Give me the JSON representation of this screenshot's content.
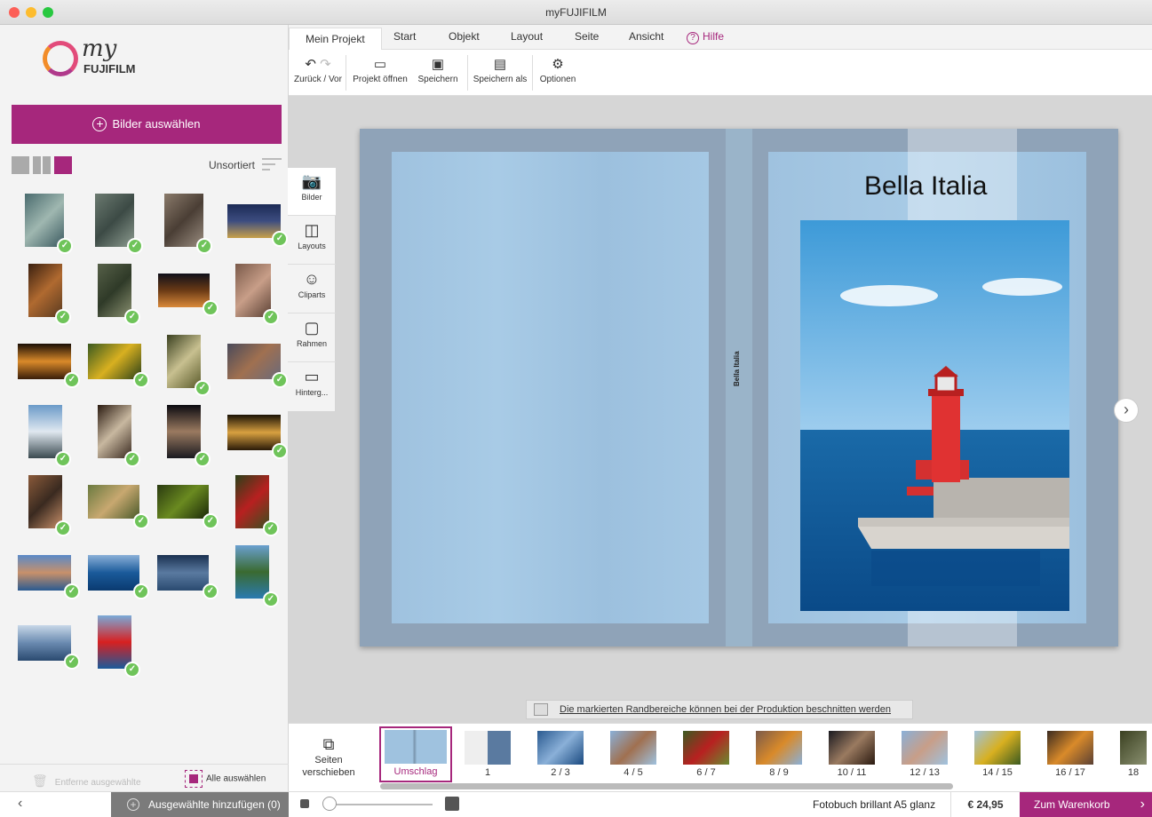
{
  "window": {
    "title": "myFUJIFILM"
  },
  "logo": {
    "my": "my",
    "brand": "FUJIFILM"
  },
  "sidebar": {
    "select_button": "Bilder auswählen",
    "sort_label": "Unsortiert",
    "remove_selected": "Entferne ausgewählte",
    "select_all": "Alle auswählen",
    "add_selected": "Ausgewählte hinzufügen (0)"
  },
  "menu": {
    "tabs": [
      "Mein Projekt",
      "Start",
      "Objekt",
      "Layout",
      "Seite",
      "Ansicht"
    ],
    "help": "Hilfe"
  },
  "ribbon": {
    "undo_redo": "Zurück / Vor",
    "open_project": "Projekt öffnen",
    "save": "Speichern",
    "save_as": "Speichern als",
    "options": "Optionen"
  },
  "side_tabs": [
    "Bilder",
    "Layouts",
    "Cliparts",
    "Rahmen",
    "Hinterg..."
  ],
  "book": {
    "title": "Bella Italia",
    "spine": "Bella Italia"
  },
  "notice": "Die markierten Randbereiche können bei der Produktion beschnitten werden",
  "pages": {
    "move_label": "Seiten verschieben",
    "items": [
      "Umschlag",
      "1",
      "2 / 3",
      "4 / 5",
      "6 / 7",
      "8 / 9",
      "10 / 11",
      "12 / 13",
      "14 / 15",
      "16 / 17",
      "18"
    ]
  },
  "bottom": {
    "product": "Fotobuch brillant A5 glanz",
    "price": "€ 24,95",
    "cart": "Zum Warenkorb"
  },
  "colors": {
    "accent": "#a6277c",
    "check": "#6fc45a"
  }
}
